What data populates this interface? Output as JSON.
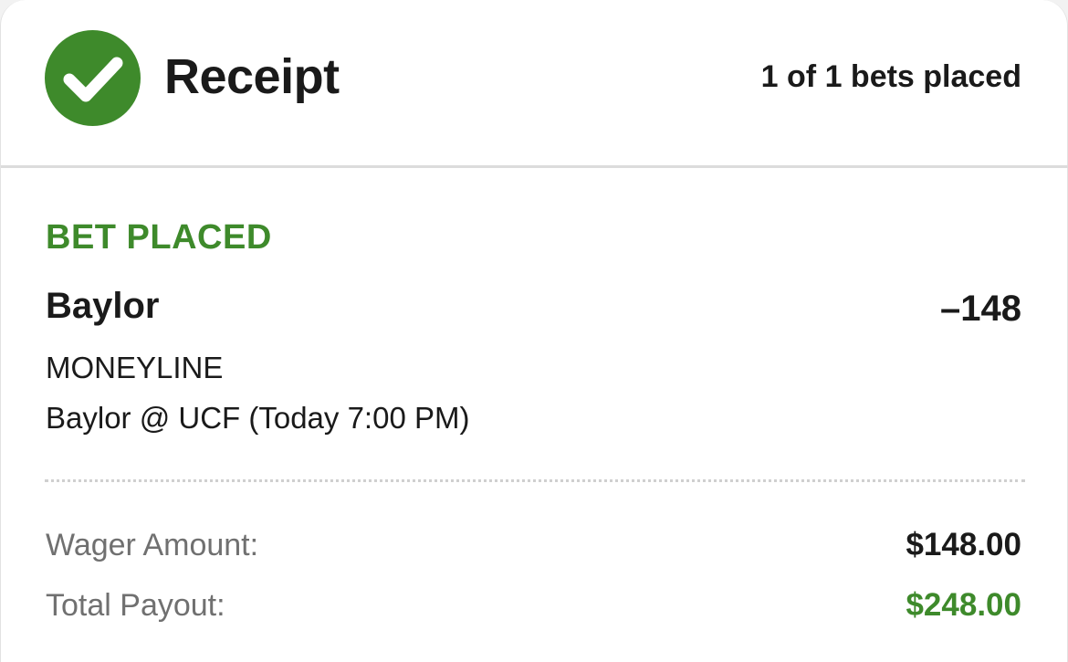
{
  "header": {
    "title": "Receipt",
    "bets_count": "1 of 1 bets placed",
    "icon": "check-circle-icon"
  },
  "bet": {
    "status": "BET PLACED",
    "selection": "Baylor",
    "odds": "–148",
    "market": "MONEYLINE",
    "event": "Baylor @ UCF (Today 7:00 PM)"
  },
  "summary": {
    "wager_label": "Wager Amount:",
    "wager_value": "$148.00",
    "payout_label": "Total Payout:",
    "payout_value": "$248.00"
  },
  "colors": {
    "accent_green": "#3e8a2b",
    "text_primary": "#1a1a1a",
    "text_secondary": "#707070",
    "divider": "#dcdcdc"
  }
}
